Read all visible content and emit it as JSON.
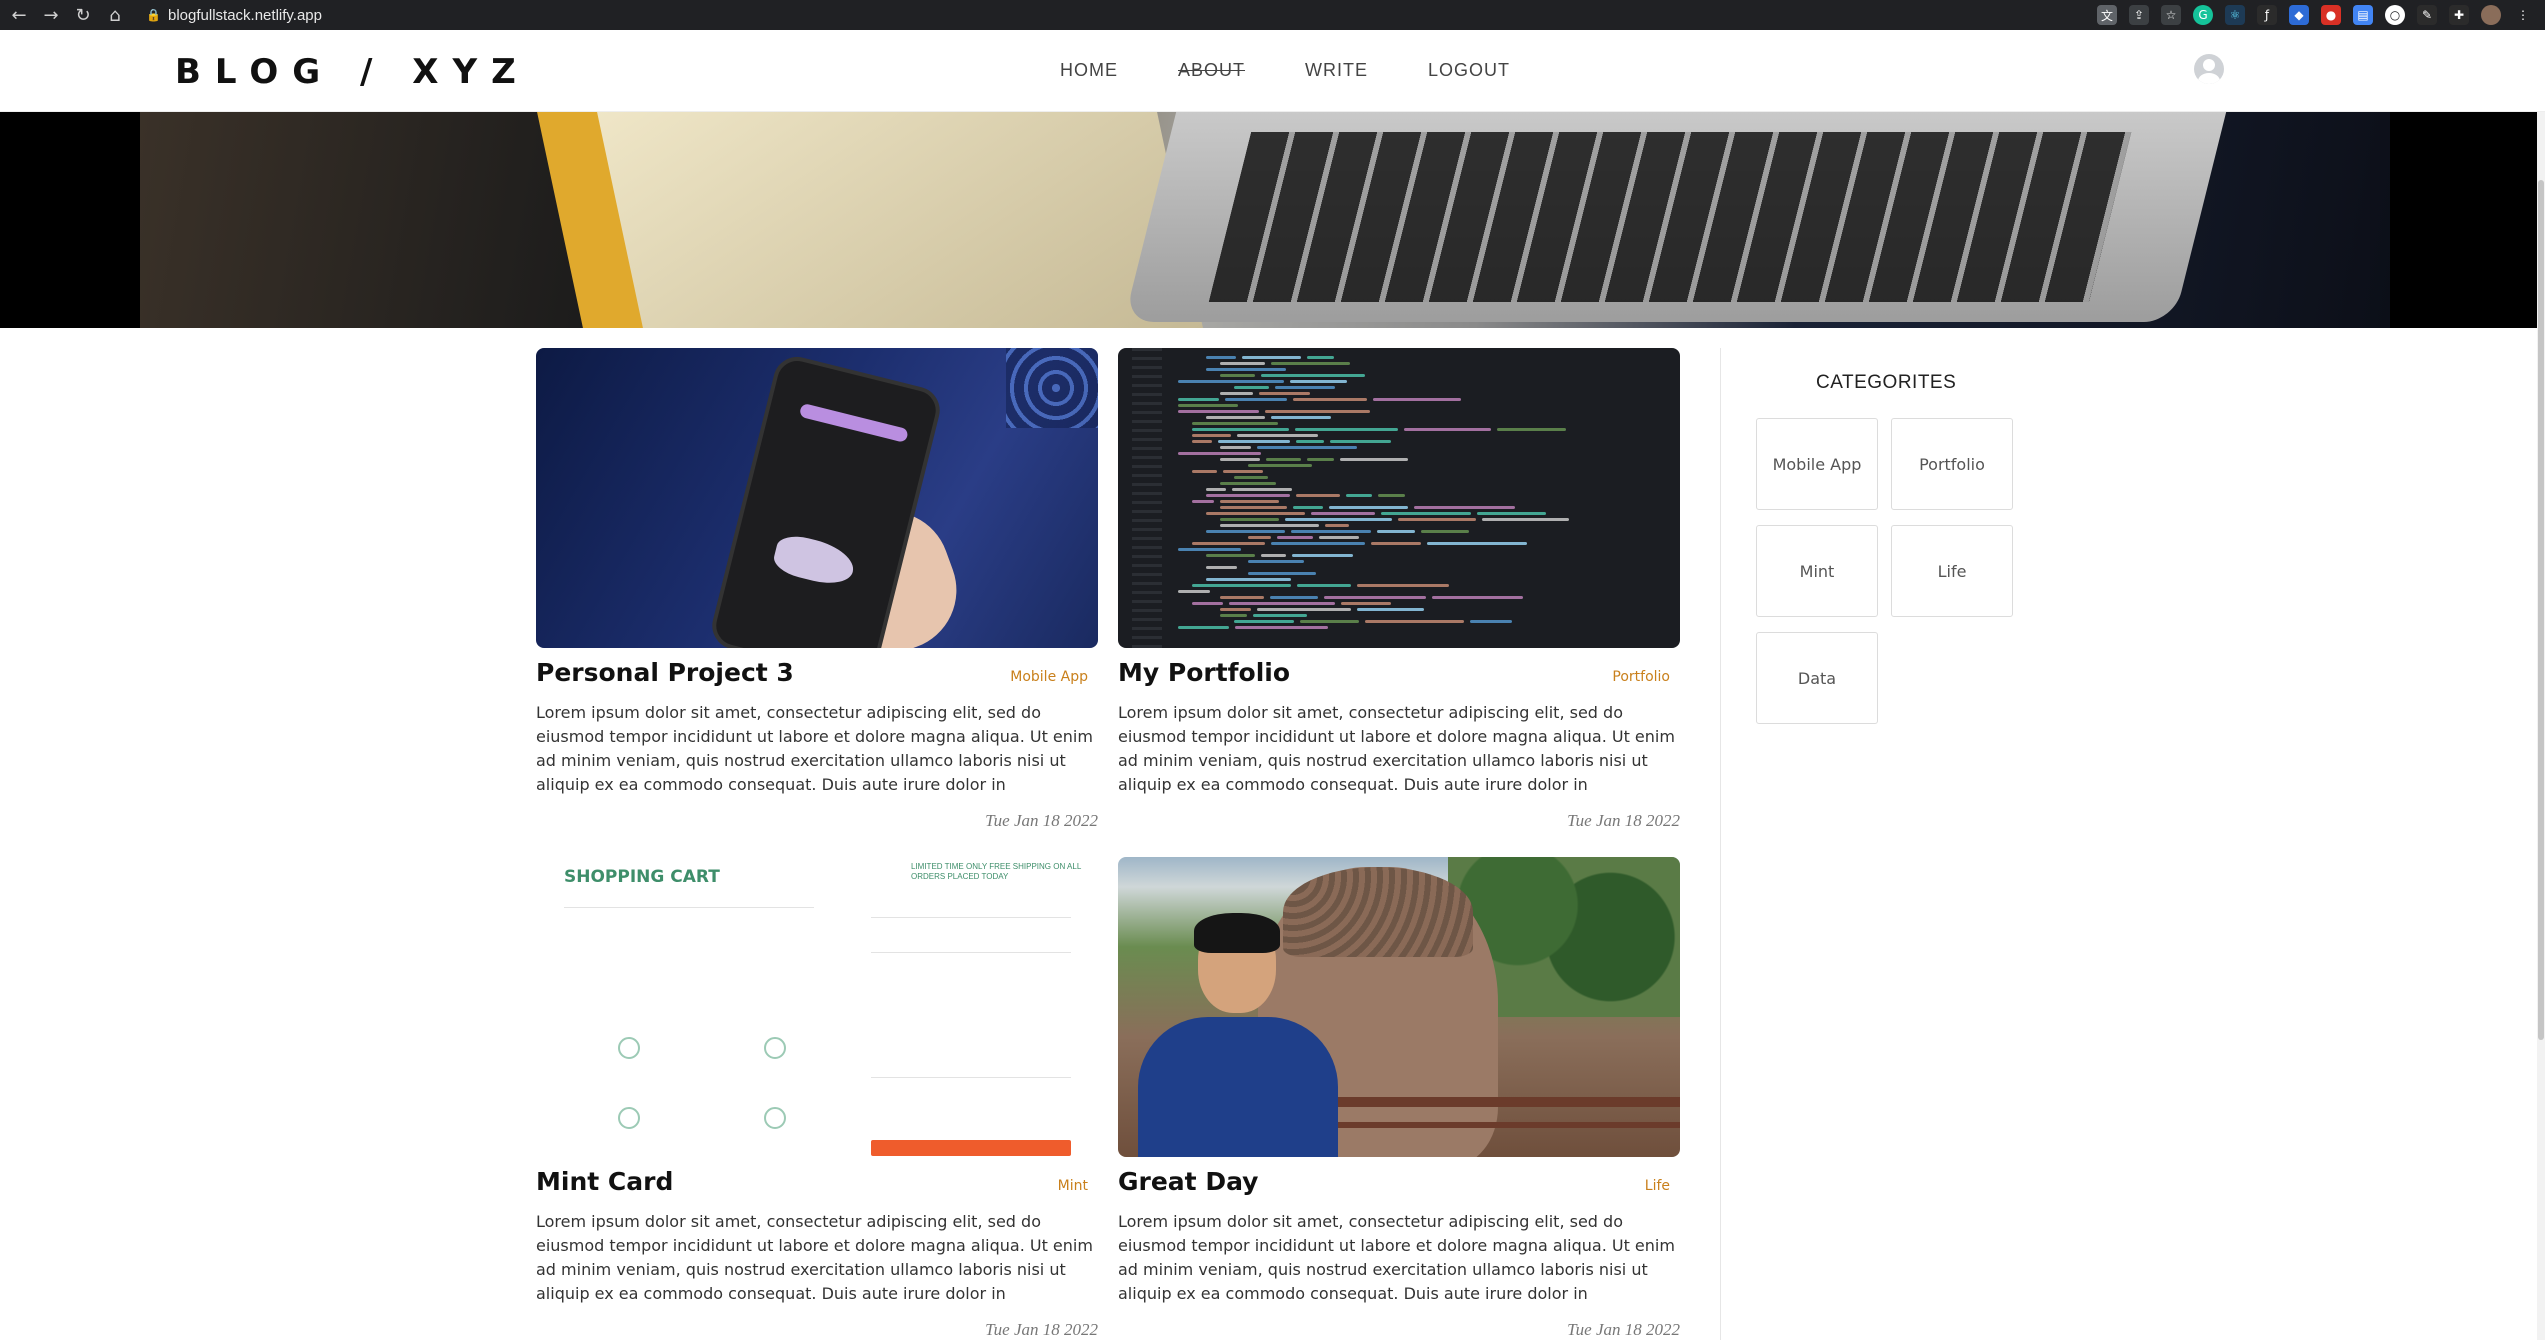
{
  "browser": {
    "url": "blogfullstack.netlify.app",
    "extension_icons": [
      "translate-icon",
      "share-icon",
      "star-icon",
      "grammarly-icon",
      "react-icon",
      "formula-icon",
      "ublock-icon",
      "ext-icon",
      "notes-icon",
      "circle-icon",
      "pen-icon",
      "puzzle-icon",
      "profile-icon",
      "menu-icon"
    ]
  },
  "header": {
    "logo": "BLOG / XYZ",
    "menu": [
      {
        "label": "HOME"
      },
      {
        "label": "ABOUT"
      },
      {
        "label": "WRITE"
      },
      {
        "label": "LOGOUT"
      }
    ]
  },
  "posts": [
    {
      "title": "Personal Project 3",
      "category": "Mobile App",
      "description": "Lorem ipsum dolor sit amet, consectetur adipiscing elit, sed do eiusmod tempor incididunt ut labore et dolore magna aliqua. Ut enim ad minim veniam, quis nostrud exercitation ullamco laboris nisi ut aliquip ex ea commodo consequat. Duis aute irure dolor in reprehenderit in voluptate…",
      "date": "Tue Jan 18 2022"
    },
    {
      "title": "My Portfolio",
      "category": "Portfolio",
      "description": "Lorem ipsum dolor sit amet, consectetur adipiscing elit, sed do eiusmod tempor incididunt ut labore et dolore magna aliqua. Ut enim ad minim veniam, quis nostrud exercitation ullamco laboris nisi ut aliquip ex ea commodo consequat. Duis aute irure dolor in reprehenderit in voluptate…",
      "date": "Tue Jan 18 2022"
    },
    {
      "title": "Mint Card",
      "category": "Mint",
      "description": "Lorem ipsum dolor sit amet, consectetur adipiscing elit, sed do eiusmod tempor incididunt ut labore et dolore magna aliqua. Ut enim ad minim veniam, quis nostrud exercitation ullamco laboris nisi ut aliquip ex ea commodo consequat. Duis aute irure dolor in reprehenderit in voluptate…",
      "date": "Tue Jan 18 2022"
    },
    {
      "title": "Great Day",
      "category": "Life",
      "description": "Lorem ipsum dolor sit amet, consectetur adipiscing elit, sed do eiusmod tempor incididunt ut labore et dolore magna aliqua. Ut enim ad minim veniam, quis nostrud exercitation ullamco laboris nisi ut aliquip ex ea commodo consequat. Duis aute irure dolor in reprehenderit in voluptate…",
      "date": "Tue Jan 18 2022"
    }
  ],
  "cart_image": {
    "heading": "SHOPPING CART",
    "banner": "LIMITED TIME ONLY FREE SHIPPING ON ALL ORDERS PLACED TODAY"
  },
  "sidebar": {
    "title": "CATEGORITES",
    "categories": [
      "Mobile App",
      "Portfolio",
      "Mint",
      "Life",
      "Data"
    ]
  },
  "colors": {
    "category_accent": "#c9801c",
    "cart_green": "#3e8e6a",
    "checkout_orange": "#ef5c2c"
  }
}
